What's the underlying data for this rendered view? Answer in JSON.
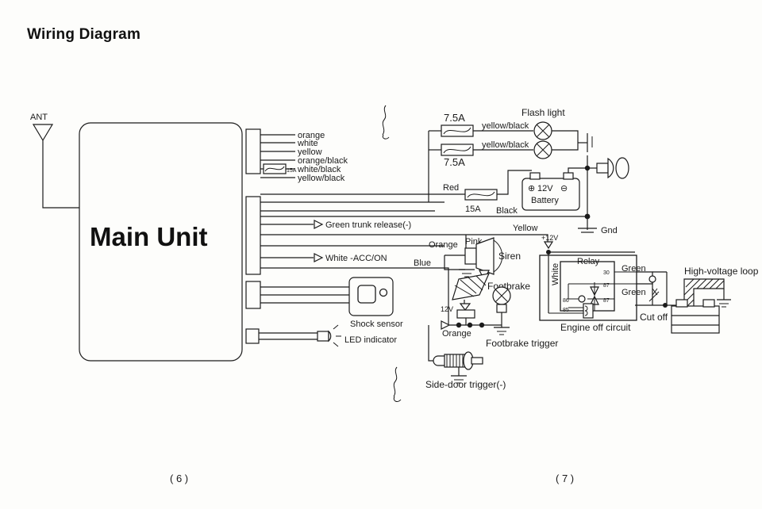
{
  "document": {
    "title": "Wiring Diagram",
    "page_numbers": [
      "( 6 )",
      "( 7 )"
    ]
  },
  "main_unit": {
    "label": "Main Unit",
    "antenna_label": "ANT"
  },
  "harness_wires": [
    {
      "label": "orange"
    },
    {
      "label": "white"
    },
    {
      "label": "yellow"
    },
    {
      "label": "orange/black"
    },
    {
      "label": "white/black"
    },
    {
      "label": "yellow/black"
    }
  ],
  "fuses": [
    {
      "rating": "15A",
      "on": "white/black"
    },
    {
      "rating": "7.5A",
      "on": "yellow/black-upper"
    },
    {
      "rating": "7.5A",
      "on": "yellow/black-lower"
    },
    {
      "rating": "15A",
      "on": "red-power"
    }
  ],
  "flash_lights": {
    "title": "Flash light",
    "wire_upper": "yellow/black",
    "wire_lower": "yellow/black"
  },
  "battery": {
    "label": "Battery",
    "voltage": "12V",
    "positive": "⊕",
    "negative": "⊖",
    "red_wire": "Red",
    "black_wire": "Black",
    "ground_label": "Gnd"
  },
  "outputs": [
    {
      "label": "Green trunk release(-)"
    },
    {
      "label": "White -ACC/ON"
    }
  ],
  "siren": {
    "label": "Siren",
    "wire_pink": "Pink",
    "wire_orange": "Orange"
  },
  "footbrake": {
    "label": "Footbrake",
    "trigger_label": "Footbrake trigger",
    "voltage": "12V",
    "wire_orange": "Orange"
  },
  "side_door": {
    "label": "Side-door  trigger(-)"
  },
  "shock_sensor": {
    "label": "Shock sensor"
  },
  "led_indicator": {
    "label": "LED indicator"
  },
  "relay": {
    "title": "Relay",
    "circuit_label": "Engine off circuit",
    "terminals": [
      "30",
      "87",
      "87",
      "86",
      "85"
    ],
    "wire_white": "White",
    "wire_green_upper": "Green",
    "wire_green_lower": "Green",
    "supply_label": "+12V"
  },
  "cut_off": {
    "label": "Cut off"
  },
  "high_voltage": {
    "label": "High-voltage loop"
  },
  "misc_labels": {
    "blue": "Blue",
    "yellow": "Yellow",
    "orange_siren": "Orange"
  },
  "colors": {
    "background": "#fdfdfb",
    "ink": "#1b1b1b",
    "text": "#1a1a1a"
  }
}
